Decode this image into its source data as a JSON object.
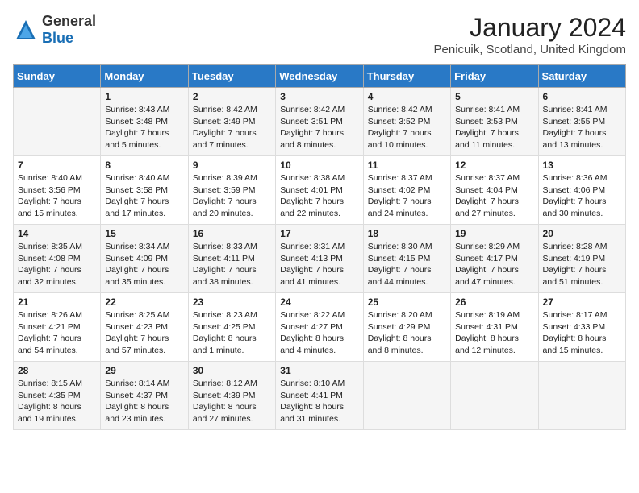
{
  "header": {
    "logo_general": "General",
    "logo_blue": "Blue",
    "month_title": "January 2024",
    "location": "Penicuik, Scotland, United Kingdom"
  },
  "days_of_week": [
    "Sunday",
    "Monday",
    "Tuesday",
    "Wednesday",
    "Thursday",
    "Friday",
    "Saturday"
  ],
  "weeks": [
    [
      {
        "day": "",
        "info": ""
      },
      {
        "day": "1",
        "info": "Sunrise: 8:43 AM\nSunset: 3:48 PM\nDaylight: 7 hours\nand 5 minutes."
      },
      {
        "day": "2",
        "info": "Sunrise: 8:42 AM\nSunset: 3:49 PM\nDaylight: 7 hours\nand 7 minutes."
      },
      {
        "day": "3",
        "info": "Sunrise: 8:42 AM\nSunset: 3:51 PM\nDaylight: 7 hours\nand 8 minutes."
      },
      {
        "day": "4",
        "info": "Sunrise: 8:42 AM\nSunset: 3:52 PM\nDaylight: 7 hours\nand 10 minutes."
      },
      {
        "day": "5",
        "info": "Sunrise: 8:41 AM\nSunset: 3:53 PM\nDaylight: 7 hours\nand 11 minutes."
      },
      {
        "day": "6",
        "info": "Sunrise: 8:41 AM\nSunset: 3:55 PM\nDaylight: 7 hours\nand 13 minutes."
      }
    ],
    [
      {
        "day": "7",
        "info": "Sunrise: 8:40 AM\nSunset: 3:56 PM\nDaylight: 7 hours\nand 15 minutes."
      },
      {
        "day": "8",
        "info": "Sunrise: 8:40 AM\nSunset: 3:58 PM\nDaylight: 7 hours\nand 17 minutes."
      },
      {
        "day": "9",
        "info": "Sunrise: 8:39 AM\nSunset: 3:59 PM\nDaylight: 7 hours\nand 20 minutes."
      },
      {
        "day": "10",
        "info": "Sunrise: 8:38 AM\nSunset: 4:01 PM\nDaylight: 7 hours\nand 22 minutes."
      },
      {
        "day": "11",
        "info": "Sunrise: 8:37 AM\nSunset: 4:02 PM\nDaylight: 7 hours\nand 24 minutes."
      },
      {
        "day": "12",
        "info": "Sunrise: 8:37 AM\nSunset: 4:04 PM\nDaylight: 7 hours\nand 27 minutes."
      },
      {
        "day": "13",
        "info": "Sunrise: 8:36 AM\nSunset: 4:06 PM\nDaylight: 7 hours\nand 30 minutes."
      }
    ],
    [
      {
        "day": "14",
        "info": "Sunrise: 8:35 AM\nSunset: 4:08 PM\nDaylight: 7 hours\nand 32 minutes."
      },
      {
        "day": "15",
        "info": "Sunrise: 8:34 AM\nSunset: 4:09 PM\nDaylight: 7 hours\nand 35 minutes."
      },
      {
        "day": "16",
        "info": "Sunrise: 8:33 AM\nSunset: 4:11 PM\nDaylight: 7 hours\nand 38 minutes."
      },
      {
        "day": "17",
        "info": "Sunrise: 8:31 AM\nSunset: 4:13 PM\nDaylight: 7 hours\nand 41 minutes."
      },
      {
        "day": "18",
        "info": "Sunrise: 8:30 AM\nSunset: 4:15 PM\nDaylight: 7 hours\nand 44 minutes."
      },
      {
        "day": "19",
        "info": "Sunrise: 8:29 AM\nSunset: 4:17 PM\nDaylight: 7 hours\nand 47 minutes."
      },
      {
        "day": "20",
        "info": "Sunrise: 8:28 AM\nSunset: 4:19 PM\nDaylight: 7 hours\nand 51 minutes."
      }
    ],
    [
      {
        "day": "21",
        "info": "Sunrise: 8:26 AM\nSunset: 4:21 PM\nDaylight: 7 hours\nand 54 minutes."
      },
      {
        "day": "22",
        "info": "Sunrise: 8:25 AM\nSunset: 4:23 PM\nDaylight: 7 hours\nand 57 minutes."
      },
      {
        "day": "23",
        "info": "Sunrise: 8:23 AM\nSunset: 4:25 PM\nDaylight: 8 hours\nand 1 minute."
      },
      {
        "day": "24",
        "info": "Sunrise: 8:22 AM\nSunset: 4:27 PM\nDaylight: 8 hours\nand 4 minutes."
      },
      {
        "day": "25",
        "info": "Sunrise: 8:20 AM\nSunset: 4:29 PM\nDaylight: 8 hours\nand 8 minutes."
      },
      {
        "day": "26",
        "info": "Sunrise: 8:19 AM\nSunset: 4:31 PM\nDaylight: 8 hours\nand 12 minutes."
      },
      {
        "day": "27",
        "info": "Sunrise: 8:17 AM\nSunset: 4:33 PM\nDaylight: 8 hours\nand 15 minutes."
      }
    ],
    [
      {
        "day": "28",
        "info": "Sunrise: 8:15 AM\nSunset: 4:35 PM\nDaylight: 8 hours\nand 19 minutes."
      },
      {
        "day": "29",
        "info": "Sunrise: 8:14 AM\nSunset: 4:37 PM\nDaylight: 8 hours\nand 23 minutes."
      },
      {
        "day": "30",
        "info": "Sunrise: 8:12 AM\nSunset: 4:39 PM\nDaylight: 8 hours\nand 27 minutes."
      },
      {
        "day": "31",
        "info": "Sunrise: 8:10 AM\nSunset: 4:41 PM\nDaylight: 8 hours\nand 31 minutes."
      },
      {
        "day": "",
        "info": ""
      },
      {
        "day": "",
        "info": ""
      },
      {
        "day": "",
        "info": ""
      }
    ]
  ]
}
